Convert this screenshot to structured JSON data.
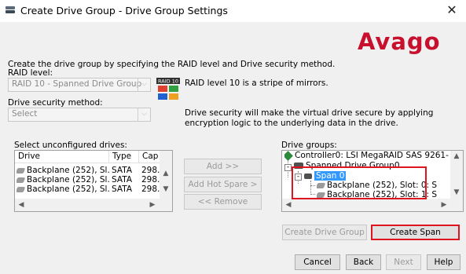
{
  "window": {
    "title": "Create Drive Group - Drive Group Settings",
    "close_glyph": "✕"
  },
  "logo": {
    "text": "Avago",
    "color": "#c8102e"
  },
  "intro": {
    "text": "Create the drive group by specifying the RAID level and Drive security method."
  },
  "raid": {
    "label": "RAID level:",
    "selected": "RAID 10 - Spanned Drive Group",
    "icon_label": "RAID 10",
    "description": "RAID level 10 is a stripe of mirrors."
  },
  "security": {
    "label": "Drive security method:",
    "selected": "Select",
    "description": "Drive security will make the virtual drive secure by applying encryption logic to the underlying data in the drive."
  },
  "unconfigured": {
    "label": "Select unconfigured drives:",
    "columns": [
      "Drive",
      "Type",
      "Cap"
    ],
    "rows": [
      {
        "drive": "Backplane (252), Sl...",
        "type": "SATA",
        "cap": "298.0"
      },
      {
        "drive": "Backplane (252), Sl...",
        "type": "SATA",
        "cap": "298.0"
      },
      {
        "drive": "Backplane (252), Sl...",
        "type": "SATA",
        "cap": "298.0"
      }
    ]
  },
  "middle_buttons": {
    "add": "Add >>",
    "add_hot_spare": "Add Hot Spare >",
    "remove": "<< Remove"
  },
  "drive_groups": {
    "label": "Drive groups:",
    "controller": "Controller0: LSI MegaRAID SAS 9261-",
    "group": "Spanned Drive Group0",
    "span": "Span 0",
    "drives": [
      "Backplane (252), Slot: 0: S",
      "Backplane (252), Slot: 1: S"
    ]
  },
  "action_buttons": {
    "create_drive_group": "Create Drive Group",
    "create_span": "Create Span"
  },
  "footer_buttons": {
    "cancel": "Cancel",
    "back": "Back",
    "next": "Next",
    "help": "Help"
  },
  "colors": {
    "highlight_red": "#e0141e",
    "selection_blue": "#3399ff"
  }
}
